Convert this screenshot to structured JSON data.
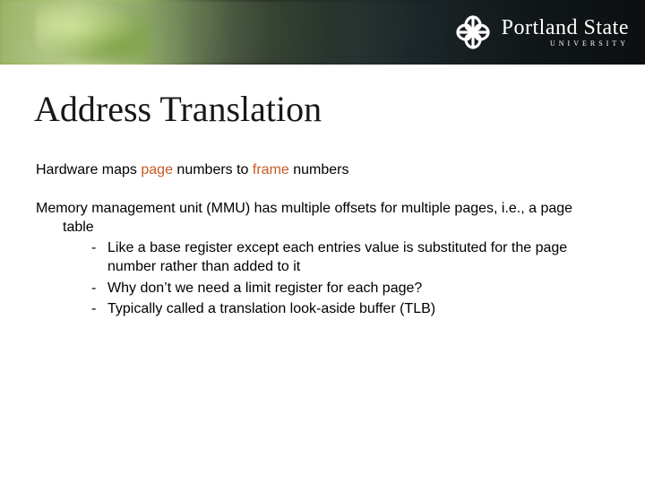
{
  "logo": {
    "name": "Portland State",
    "sub": "UNIVERSITY"
  },
  "title": "Address Translation",
  "p1_a": "Hardware maps ",
  "p1_b": "page",
  "p1_c": " numbers to ",
  "p1_d": "frame",
  "p1_e": " numbers",
  "p2": "Memory management unit (MMU) has multiple offsets for multiple pages, i.e., a page table",
  "dash": "-",
  "b1": "Like a base register except each entries value is substituted for the page number rather than added to it",
  "b2": "Why don’t we need a limit register for each page?",
  "b3": "Typically called a translation look-aside buffer (TLB)"
}
